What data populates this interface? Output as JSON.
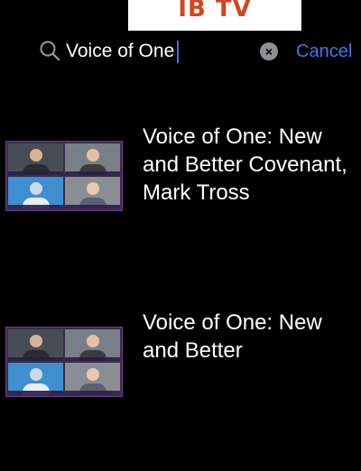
{
  "header": {
    "logo_text": "IB TV"
  },
  "search": {
    "icon": "search-icon",
    "value": "Voice of One",
    "cancel_label": "Cancel",
    "clear_icon": "clear-icon",
    "accent_color": "#3b78e7"
  },
  "results": [
    {
      "title": "Voice of One: New and Better Covenant, Mark Tross"
    },
    {
      "title": "Voice of One: New and Better"
    }
  ]
}
